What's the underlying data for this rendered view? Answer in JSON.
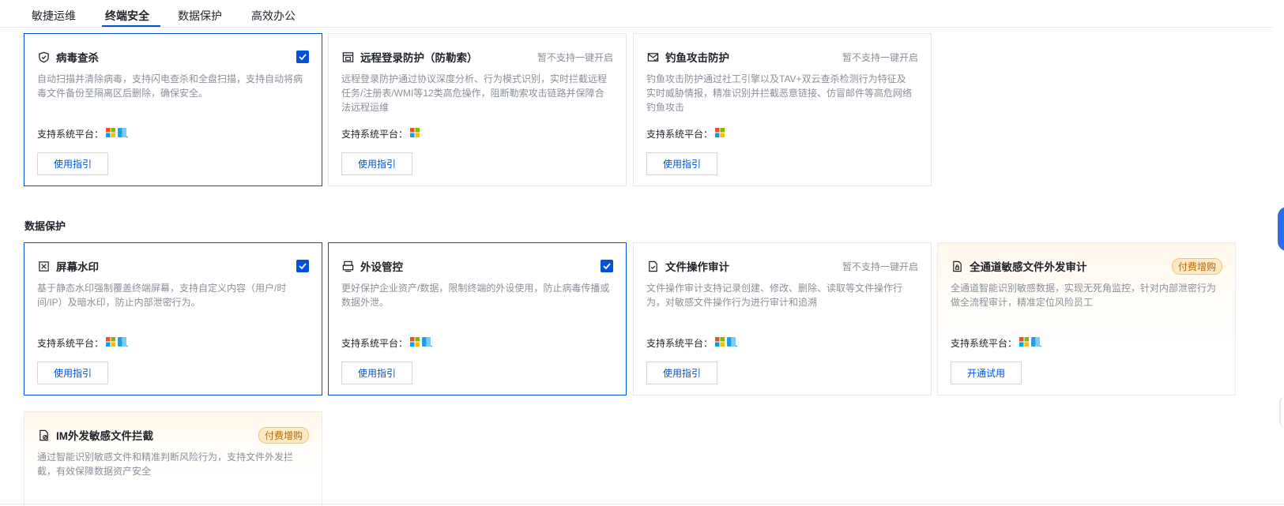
{
  "tabs": [
    {
      "label": "敏捷运维"
    },
    {
      "label": "终端安全"
    },
    {
      "label": "数据保护"
    },
    {
      "label": "高效办公"
    }
  ],
  "active_tab": "终端安全",
  "section": {
    "data_protection_title": "数据保护"
  },
  "platform_label": "支持系统平台：",
  "cards": {
    "virus": {
      "title": "病毒查杀",
      "desc": "自动扫描并清除病毒，支持闪电查杀和全盘扫描，支持自动将病毒文件备份至隔离区后删除，确保安全。",
      "button": "使用指引",
      "checked": true,
      "platforms": [
        "windows-icon",
        "mac-icon"
      ]
    },
    "remote": {
      "title": "远程登录防护（防勒索）",
      "status": "暂不支持一键开启",
      "desc": "远程登录防护通过协议深度分析、行为模式识别，实时拦截远程任务/注册表/WMI等12类高危操作，阻断勒索攻击链路并保障合法远程运维",
      "button": "使用指引",
      "platforms": [
        "windows-icon"
      ]
    },
    "phishing": {
      "title": "钓鱼攻击防护",
      "status": "暂不支持一键开启",
      "desc": "钓鱼攻击防护通过社工引擎以及TAV+双云查杀检测行为特征及实时威胁情报，精准识别并拦截恶意链接、仿冒邮件等高危网络钓鱼攻击",
      "button": "使用指引",
      "platforms": [
        "windows-icon"
      ]
    },
    "watermark": {
      "title": "屏幕水印",
      "desc": "基于静态水印强制覆盖终端屏幕，支持自定义内容（用户/时间/IP）及暗水印，防止内部泄密行为。",
      "button": "使用指引",
      "checked": true,
      "platforms": [
        "windows-icon",
        "mac-icon"
      ]
    },
    "peripheral": {
      "title": "外设管控",
      "desc": "更好保护企业资产/数据，限制终端的外设使用，防止病毒传播或数据外泄。",
      "button": "使用指引",
      "checked": true,
      "platforms": [
        "windows-icon",
        "mac-icon"
      ]
    },
    "audit": {
      "title": "文件操作审计",
      "status": "暂不支持一键开启",
      "desc": "文件操作审计支持记录创建、修改、删除、读取等文件操作行为，对敏感文件操作行为进行审计和追溯",
      "button": "使用指引",
      "platforms": [
        "windows-icon",
        "mac-icon"
      ]
    },
    "allchannel": {
      "title": "全通道敏感文件外发审计",
      "badge": "付费增购",
      "desc": "全通道智能识别敏感数据，实现无死角监控，针对内部泄密行为做全流程审计，精准定位风险员工",
      "button": "开通试用",
      "platforms": [
        "windows-icon",
        "mac-icon"
      ]
    },
    "im": {
      "title": "IM外发敏感文件拦截",
      "badge": "付费增购",
      "desc": "通过智能识别敏感文件和精准判断风险行为，支持文件外发拦截，有效保障数据资产安全"
    }
  },
  "colors": {
    "primary": "#0052d9",
    "muted_text": "#8a8f99",
    "paid_badge_bg": "#fde9c6",
    "paid_badge_text": "#b56a00"
  }
}
